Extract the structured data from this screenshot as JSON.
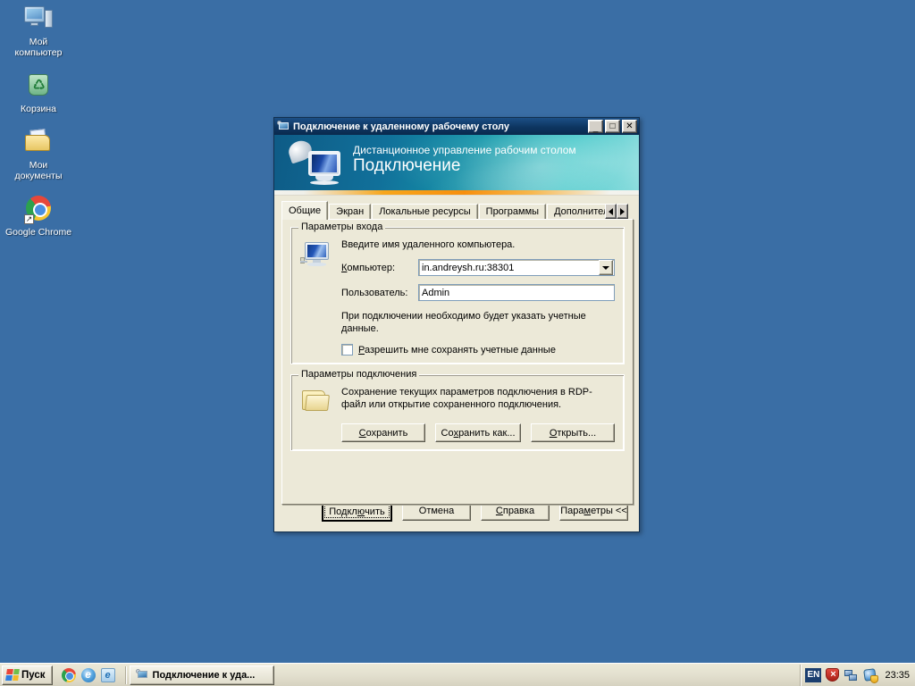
{
  "desktop": {
    "background_color": "#3a6ea5",
    "icons": [
      {
        "name": "my-computer",
        "label": "Мой\nкомпьютер",
        "label_lines": [
          "Мой",
          "компьютер"
        ]
      },
      {
        "name": "recycle-bin",
        "label": "Корзина",
        "label_lines": [
          "Корзина"
        ]
      },
      {
        "name": "my-documents",
        "label": "Мои\nдокументы",
        "label_lines": [
          "Мои",
          "документы"
        ]
      },
      {
        "name": "google-chrome",
        "label": "Google Chrome",
        "label_lines": [
          "Google Chrome"
        ]
      }
    ]
  },
  "window": {
    "title": "Подключение к удаленному рабочему столу",
    "titlebar_color": "#0d3560",
    "controls": {
      "minimize": "_",
      "maximize": "□",
      "close": "✕"
    },
    "banner": {
      "subtitle": "Дистанционное управление рабочим столом",
      "title": "Подключение",
      "accent_color": "#f78f0d",
      "gradient_from": "#0e5b86",
      "gradient_to": "#7fd9da"
    },
    "tabs": [
      {
        "label": "Общие",
        "active": true
      },
      {
        "label": "Экран",
        "active": false
      },
      {
        "label": "Локальные ресурсы",
        "active": false
      },
      {
        "label": "Программы",
        "active": false
      },
      {
        "label": "Дополнительные",
        "active": false,
        "clipped": true
      }
    ],
    "tab_scroll": {
      "left": "◀",
      "right": "▶"
    },
    "logon_group": {
      "legend": "Параметры входа",
      "description": "Введите имя удаленного компьютера.",
      "computer_label": "Компьютер:",
      "computer_value": "in.andreysh.ru:38301",
      "user_label": "Пользователь:",
      "user_value": "Admin",
      "note": "При подключении необходимо будет указать учетные данные.",
      "checkbox_label": "Разрешить мне сохранять учетные данные",
      "checkbox_checked": false
    },
    "connection_group": {
      "legend": "Параметры подключения",
      "description": "Сохранение текущих параметров подключения в RDP-файл или открытие сохраненного подключения.",
      "buttons": [
        {
          "label": "Сохранить"
        },
        {
          "label": "Сохранить как..."
        },
        {
          "label": "Открыть..."
        }
      ]
    },
    "dialog_buttons": [
      {
        "label": "Подключить",
        "default": true
      },
      {
        "label": "Отмена",
        "default": false
      },
      {
        "label": "Справка",
        "default": false
      },
      {
        "label": "Параметры <<",
        "default": false
      }
    ]
  },
  "taskbar": {
    "start_label": "Пуск",
    "quick_launch": [
      {
        "name": "chrome-icon"
      },
      {
        "name": "internet-explorer-icon"
      },
      {
        "name": "internet-explorer-alt-icon"
      }
    ],
    "tasks": [
      {
        "label": "Подключение к уда..."
      }
    ],
    "tray": {
      "language": "EN",
      "icons": [
        {
          "name": "security-shield-icon"
        },
        {
          "name": "network-connection-icon"
        },
        {
          "name": "windows-update-icon"
        }
      ],
      "clock": "23:35"
    }
  }
}
